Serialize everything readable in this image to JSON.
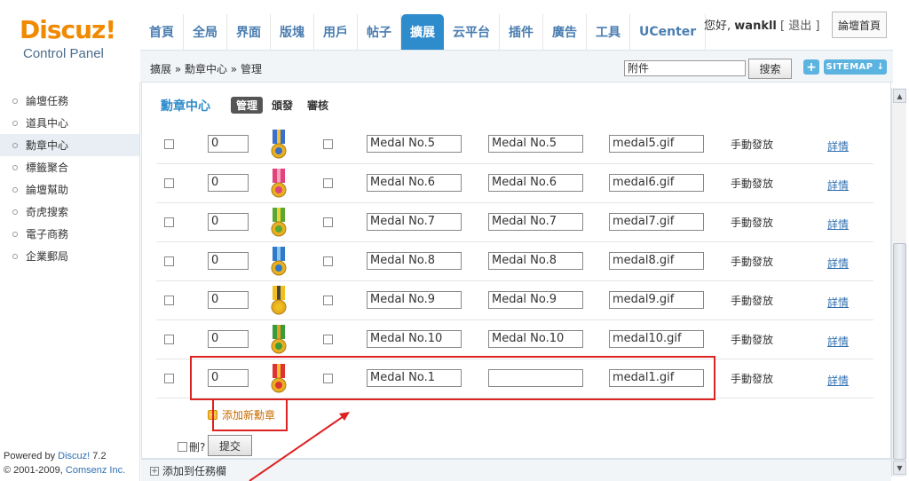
{
  "logo": {
    "brand": "Discuz!",
    "sub": "Control Panel"
  },
  "nav": {
    "tabs": [
      "首頁",
      "全局",
      "界面",
      "版塊",
      "用戶",
      "帖子",
      "擴展",
      "云平台",
      "插件",
      "廣告",
      "工具",
      "UCenter"
    ],
    "active_index": 6
  },
  "user": {
    "greeting": "您好,",
    "name": "wankll",
    "logout": "[ 退出 ]",
    "forum_home": "論壇首頁"
  },
  "breadcrumb": "擴展 » 勳章中心 » 管理",
  "search": {
    "value": "附件",
    "button": "搜索"
  },
  "sitemap": {
    "plus": "+",
    "label": "SITEMAP ↓"
  },
  "sidebar": {
    "items": [
      "論壇任務",
      "道具中心",
      "勳章中心",
      "標籤聚合",
      "論壇幫助",
      "奇虎搜索",
      "電子商務",
      "企業郵局"
    ],
    "active_index": 2,
    "powered_prefix": "Powered by ",
    "powered_link": "Discuz!",
    "powered_version": " 7.2",
    "copyright_prefix": "© 2001-2009, ",
    "copyright_link": "Comsenz Inc."
  },
  "main": {
    "title": "勳章中心",
    "subtabs": [
      "管理",
      "頒發",
      "審核"
    ],
    "rows": [
      {
        "order": "0",
        "name": "Medal No.5",
        "desc": "Medal No.5",
        "image": "medal5.gif",
        "method": "手動發放",
        "detail": "詳情"
      },
      {
        "order": "0",
        "name": "Medal No.6",
        "desc": "Medal No.6",
        "image": "medal6.gif",
        "method": "手動發放",
        "detail": "詳情"
      },
      {
        "order": "0",
        "name": "Medal No.7",
        "desc": "Medal No.7",
        "image": "medal7.gif",
        "method": "手動發放",
        "detail": "詳情"
      },
      {
        "order": "0",
        "name": "Medal No.8",
        "desc": "Medal No.8",
        "image": "medal8.gif",
        "method": "手動發放",
        "detail": "詳情"
      },
      {
        "order": "0",
        "name": "Medal No.9",
        "desc": "Medal No.9",
        "image": "medal9.gif",
        "method": "手動發放",
        "detail": "詳情"
      },
      {
        "order": "0",
        "name": "Medal No.10",
        "desc": "Medal No.10",
        "image": "medal10.gif",
        "method": "手動發放",
        "detail": "詳情"
      },
      {
        "order": "0",
        "name": "Medal No.1",
        "desc": "",
        "image": "medal1.gif",
        "method": "手動發放",
        "detail": "詳情"
      }
    ],
    "add_medal": "添加新勳章",
    "delete_label": "刪?",
    "submit": "提交"
  },
  "footer": {
    "add_to_taskbar": "添加到任務欄"
  },
  "colors": {
    "accent": "#2f8ccc",
    "brand_orange": "#f08a00",
    "annotation_red": "#d22222"
  }
}
